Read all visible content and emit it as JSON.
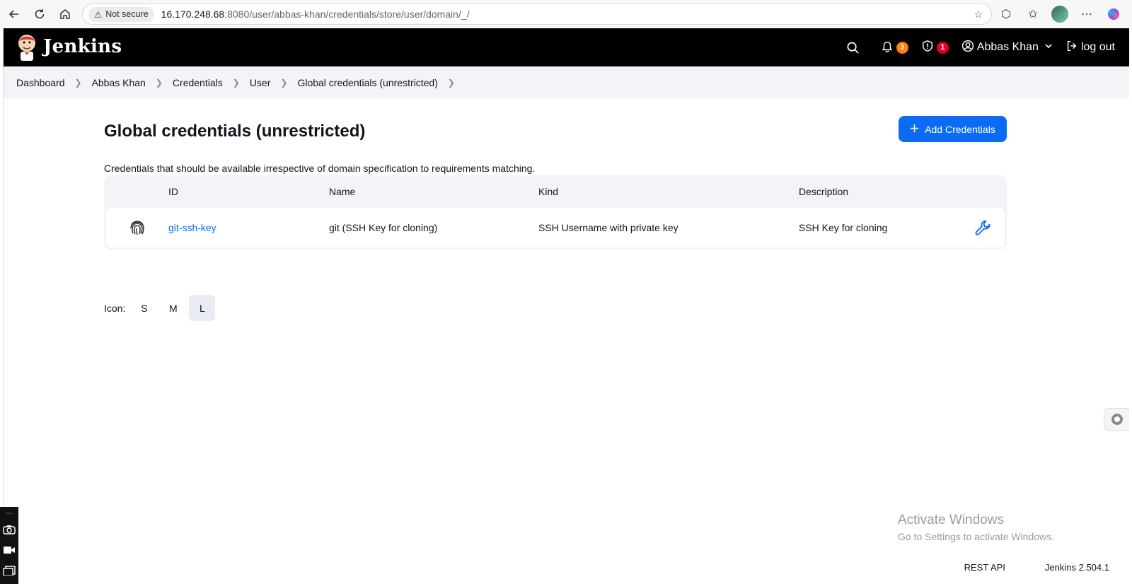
{
  "browser": {
    "security_label": "Not secure",
    "url_host": "16.170.248.68",
    "url_rest": ":8080/user/abbas-khan/credentials/store/user/domain/_/"
  },
  "header": {
    "app_name": "Jenkins",
    "notifications_count": "3",
    "security_count": "1",
    "user_name": "Abbas Khan",
    "logout_label": "log out"
  },
  "breadcrumbs": [
    "Dashboard",
    "Abbas Khan",
    "Credentials",
    "User",
    "Global credentials (unrestricted)"
  ],
  "main": {
    "title": "Global credentials (unrestricted)",
    "add_button": "Add Credentials",
    "description": "Credentials that should be available irrespective of domain specification to requirements matching."
  },
  "table": {
    "headers": {
      "id": "ID",
      "name": "Name",
      "kind": "Kind",
      "description": "Description"
    },
    "rows": [
      {
        "id": "git-ssh-key",
        "name": "git (SSH Key for cloning)",
        "kind": "SSH Username with private key",
        "description": "SSH Key for cloning",
        "icon": "fingerprint-icon"
      }
    ]
  },
  "icon_size": {
    "label": "Icon:",
    "options": [
      "S",
      "M",
      "L"
    ],
    "selected": "L"
  },
  "footer": {
    "rest_api": "REST API",
    "version": "Jenkins 2.504.1"
  },
  "watermark": {
    "line1": "Activate Windows",
    "line2": "Go to Settings to activate Windows."
  },
  "colors": {
    "header_bg": "#000000",
    "accent": "#0b6bf5",
    "badge_orange": "#fe820a",
    "badge_red": "#e6001f"
  }
}
